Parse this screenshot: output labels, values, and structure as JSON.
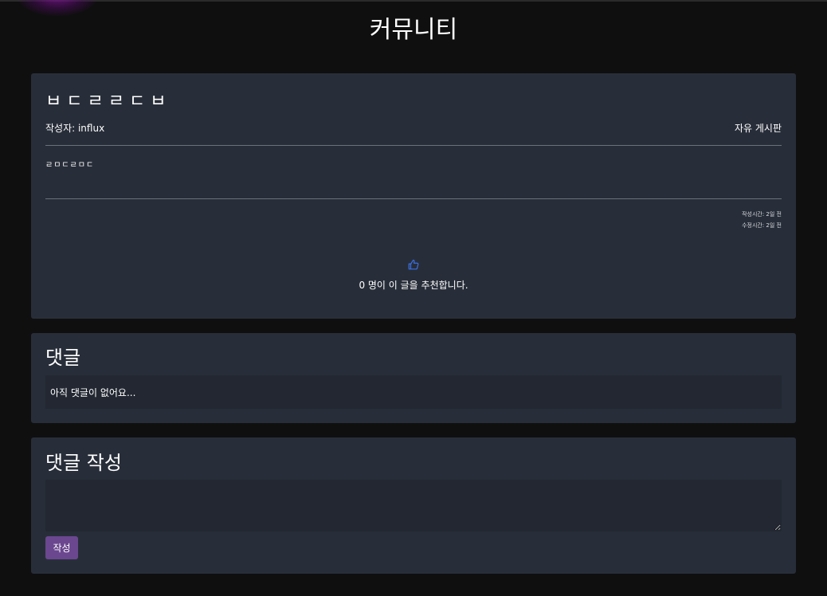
{
  "page": {
    "title": "커뮤니티"
  },
  "post": {
    "title": "ㅂㄷㄹㄹㄷㅂ",
    "author_label": "작성자: influx",
    "board_name": "자유 게시판",
    "body": "ㄹㅁㄷㄹㅁㄷ",
    "created_label": "작성시간: 2일 전",
    "modified_label": "수정시간: 2일 전",
    "recommend_text": "0 명이 이 글을 추천합니다.",
    "recommend_icon": "thumbs-up-icon"
  },
  "comments": {
    "title": "댓글",
    "empty_text": "아직 댓글이 없어요..."
  },
  "write_comment": {
    "title": "댓글 작성",
    "textarea_value": "",
    "submit_label": "작성"
  },
  "colors": {
    "background": "#0f0f0f",
    "card": "#282e39",
    "inner_panel": "#222731",
    "accent_button": "#6b478f",
    "icon_blue": "#3b6fe0"
  }
}
